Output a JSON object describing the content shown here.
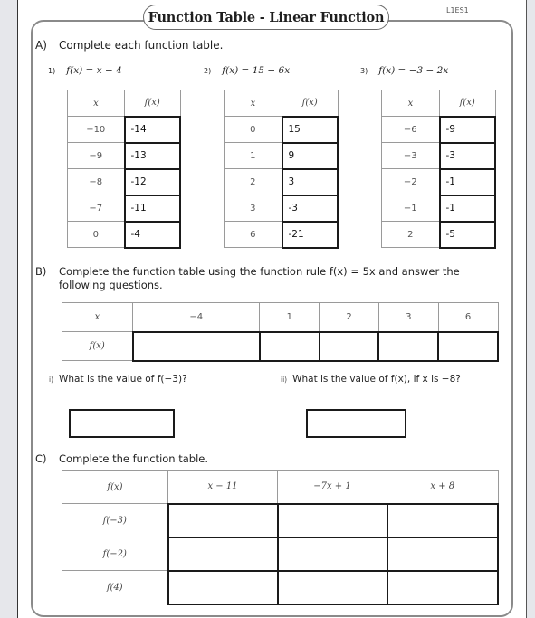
{
  "worksheet": {
    "title": "Function Table - Linear Function",
    "code": "L1ES1"
  },
  "section_a": {
    "label": "A)",
    "instruction": "Complete each function table.",
    "problems": [
      {
        "number": "1)",
        "rule": "f(x) = x − 4",
        "headers": [
          "x",
          "f(x)"
        ],
        "rows": [
          {
            "x": "−10",
            "fx": "-14"
          },
          {
            "x": "−9",
            "fx": "-13"
          },
          {
            "x": "−8",
            "fx": "-12"
          },
          {
            "x": "−7",
            "fx": "-11"
          },
          {
            "x": "0",
            "fx": "-4"
          }
        ]
      },
      {
        "number": "2)",
        "rule": "f(x) = 15 − 6x",
        "headers": [
          "x",
          "f(x)"
        ],
        "rows": [
          {
            "x": "0",
            "fx": "15"
          },
          {
            "x": "1",
            "fx": "9"
          },
          {
            "x": "2",
            "fx": "3"
          },
          {
            "x": "3",
            "fx": "-3"
          },
          {
            "x": "6",
            "fx": "-21"
          }
        ]
      },
      {
        "number": "3)",
        "rule": "f(x) = −3 − 2x",
        "headers": [
          "x",
          "f(x)"
        ],
        "rows": [
          {
            "x": "−6",
            "fx": "-9"
          },
          {
            "x": "−3",
            "fx": "-3"
          },
          {
            "x": "−2",
            "fx": "-1"
          },
          {
            "x": "−1",
            "fx": "-1"
          },
          {
            "x": "2",
            "fx": "-5"
          }
        ]
      }
    ]
  },
  "section_b": {
    "label": "B)",
    "instruction_line1": "Complete the function table using the function rule f(x) = 5x and answer the",
    "instruction_line2": "following questions.",
    "row_x_label": "x",
    "row_fx_label": "f(x)",
    "x_values": [
      "−4",
      "1",
      "2",
      "3",
      "6"
    ],
    "fx_values": [
      "",
      "",
      "",
      "",
      ""
    ],
    "questions": [
      {
        "number": "i)",
        "text": "What is the value of f(−3)?",
        "answer": ""
      },
      {
        "number": "ii)",
        "text": "What is the value of f(x), if x is −8?",
        "answer": ""
      }
    ]
  },
  "section_c": {
    "label": "C)",
    "instruction": "Complete the function table.",
    "corner_label": "f(x)",
    "functions": [
      "x − 11",
      "−7x + 1",
      "x + 8"
    ],
    "rows": [
      {
        "input": "f(−3)",
        "answers": [
          "",
          "",
          ""
        ]
      },
      {
        "input": "f(−2)",
        "answers": [
          "",
          "",
          ""
        ]
      },
      {
        "input": "f(4)",
        "answers": [
          "",
          "",
          ""
        ]
      }
    ]
  }
}
